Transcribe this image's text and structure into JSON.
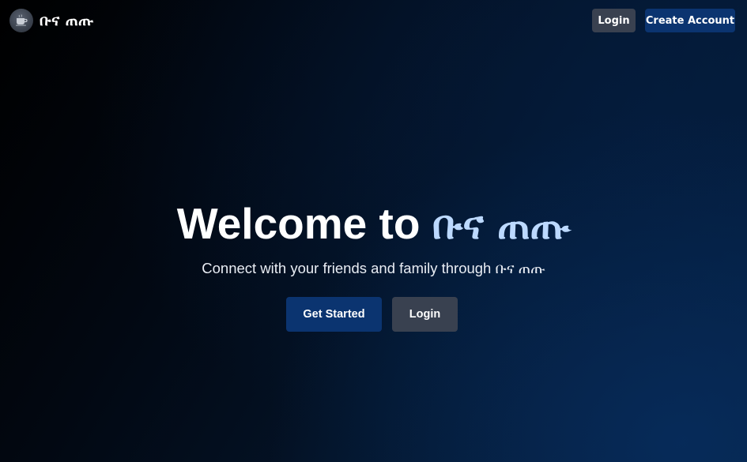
{
  "header": {
    "brand_name": "ቡና ጠጡ",
    "logo_icon": "coffee-cup-icon",
    "login_label": "Login",
    "create_account_label": "Create Account"
  },
  "hero": {
    "title_prefix": "Welcome to ",
    "title_accent": "ቡና ጠጡ",
    "subtitle": "Connect with your friends and family through ቡና ጠጡ",
    "get_started_label": "Get Started",
    "login_label": "Login"
  },
  "colors": {
    "primary_button": "#0b3470",
    "secondary_button": "#394150",
    "accent_text": "#bcd9ff",
    "background_dark": "#000000",
    "background_light": "#062042"
  }
}
